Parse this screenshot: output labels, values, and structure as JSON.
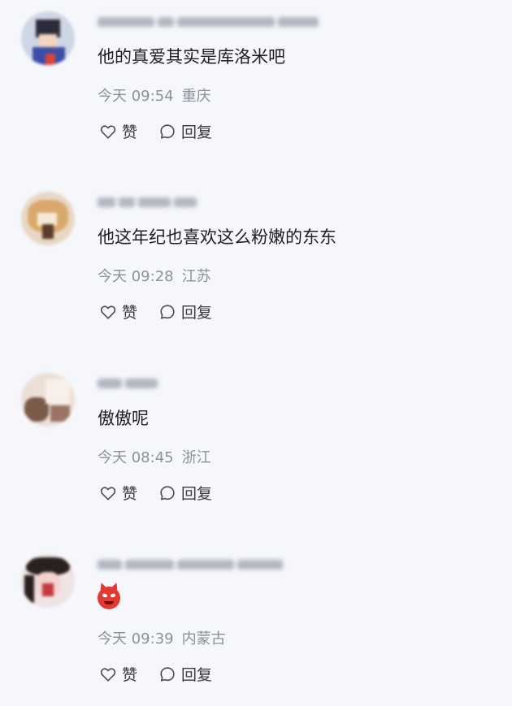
{
  "comments": [
    {
      "content": "他的真爱其实是库洛米吧",
      "time": "今天 09:54",
      "location": "重庆",
      "like_label": "赞",
      "reply_label": "回复"
    },
    {
      "content": "他这年纪也喜欢这么粉嫩的东东",
      "time": "今天 09:28",
      "location": "江苏",
      "like_label": "赞",
      "reply_label": "回复"
    },
    {
      "content": "傲傲呢",
      "time": "今天 08:45",
      "location": "浙江",
      "like_label": "赞",
      "reply_label": "回复"
    },
    {
      "content_emoji": "devil-emoji",
      "time": "今天 09:39",
      "location": "内蒙古",
      "like_label": "赞",
      "reply_label": "回复"
    }
  ],
  "icons": {
    "like": "heart-icon",
    "reply": "comment-bubble-icon"
  },
  "colors": {
    "background": "#f5f7fb",
    "text": "#1f1f1f",
    "meta": "#8d9099",
    "emoji": "#e23a32"
  }
}
